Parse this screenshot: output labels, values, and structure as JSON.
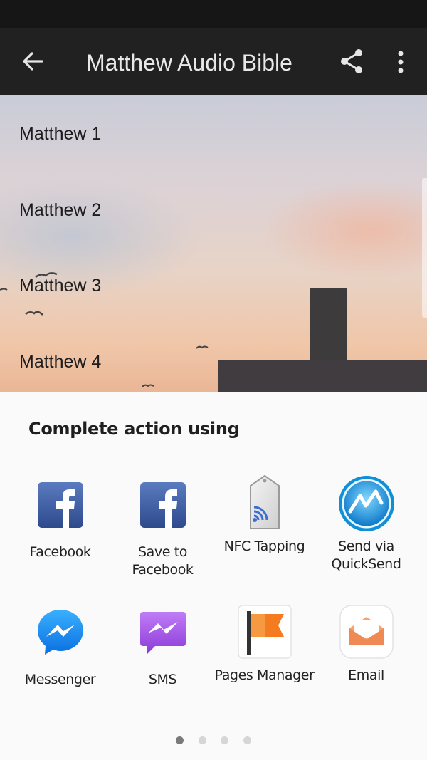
{
  "appbar": {
    "title": "Matthew Audio Bible",
    "back_icon": "arrow-left-icon",
    "share_icon": "share-icon",
    "more_icon": "more-vert-icon"
  },
  "chapters": [
    "Matthew 1",
    "Matthew 2",
    "Matthew 3",
    "Matthew 4"
  ],
  "share_sheet": {
    "title": "Complete action using",
    "apps": [
      {
        "label": "Facebook",
        "icon": "facebook-icon"
      },
      {
        "label": "Save to Facebook",
        "icon": "facebook-icon"
      },
      {
        "label": "NFC Tapping",
        "icon": "nfc-icon"
      },
      {
        "label": "Send via QuickSend",
        "icon": "quicksend-icon"
      },
      {
        "label": "Messenger",
        "icon": "messenger-icon"
      },
      {
        "label": "SMS",
        "icon": "sms-icon"
      },
      {
        "label": "Pages Manager",
        "icon": "pages-manager-icon"
      },
      {
        "label": "Email",
        "icon": "email-icon"
      }
    ],
    "pages": 4,
    "current_page": 1
  },
  "colors": {
    "appbar": "#212121",
    "facebook": "#3b5998",
    "messenger": "#0a84ff",
    "sms": "#a64fe0",
    "email": "#f08a55"
  }
}
